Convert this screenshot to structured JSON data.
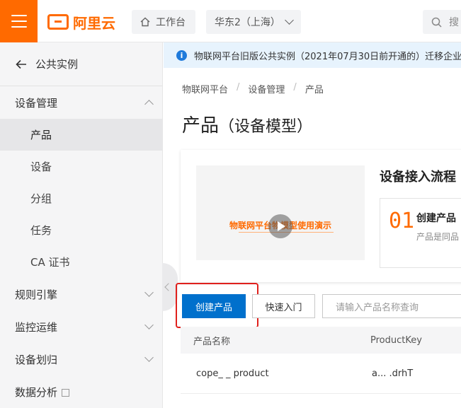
{
  "header": {
    "logo_text": "阿里云",
    "workbench_label": "工作台",
    "region_label": "华东2（上海）",
    "search_placeholder": "搜"
  },
  "sidebar": {
    "back_label": "公共实例",
    "groups": [
      {
        "label": "设备管理",
        "expanded": true,
        "items": [
          {
            "label": "产品",
            "active": true
          },
          {
            "label": "设备",
            "active": false
          },
          {
            "label": "分组",
            "active": false
          },
          {
            "label": "任务",
            "active": false
          },
          {
            "label": "CA 证书",
            "active": false
          }
        ]
      },
      {
        "label": "规则引擎",
        "expanded": false
      },
      {
        "label": "监控运维",
        "expanded": false
      },
      {
        "label": "设备划归",
        "expanded": false
      },
      {
        "label": "数据分析",
        "external": true
      }
    ]
  },
  "notice": {
    "text": "物联网平台旧版公共实例（2021年07月30日前开通的）迁移企业"
  },
  "breadcrumb": [
    "物联网平台",
    "设备管理",
    "产品"
  ],
  "page": {
    "title": "产品",
    "subtitle": "（设备模型）"
  },
  "flow": {
    "video_title": "物联网平台物模型使用演示",
    "heading": "设备接入流程",
    "step_number": "01",
    "step_title": "创建产品",
    "step_desc": "产品是同品"
  },
  "actions": {
    "create_label": "创建产品",
    "quickstart_label": "快速入门",
    "search_placeholder": "请输入产品名称查询"
  },
  "table": {
    "columns": [
      "产品名称",
      "ProductKey"
    ],
    "rows": [
      [
        "cope_  _ product",
        "a... .drhT"
      ]
    ]
  },
  "colors": {
    "brand": "#ff6a00",
    "primary": "#0070cc",
    "highlight": "#e0201c"
  }
}
